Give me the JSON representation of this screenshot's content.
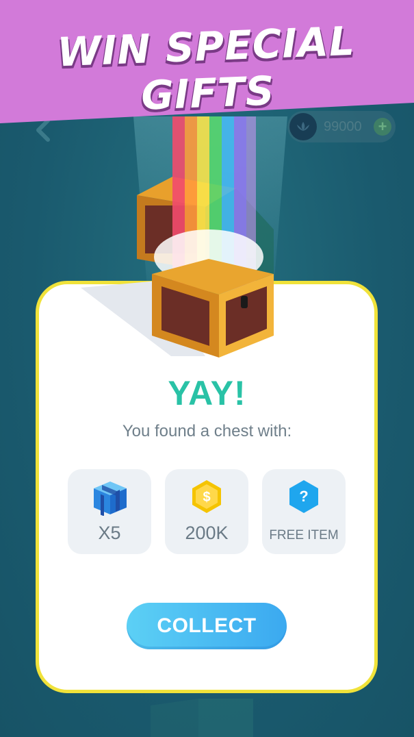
{
  "banner": {
    "title": "WIN SPECIAL GIFTS"
  },
  "header": {
    "coins": "99000",
    "plus": "+"
  },
  "card": {
    "heading": "YAY!",
    "subtitle": "You found a chest with:",
    "rewards": [
      {
        "icon": "gift-box-icon",
        "label": "X5"
      },
      {
        "icon": "coin-icon",
        "label": "200K",
        "icon_text": "$"
      },
      {
        "icon": "question-icon",
        "label": "FREE ITEM",
        "icon_text": "?"
      }
    ],
    "collect_label": "COLLECT"
  },
  "colors": {
    "banner": "#d27ad9",
    "background": "#1d5f73",
    "card_border": "#f0e23a",
    "heading": "#29c2a6",
    "button": "#3ba9f0"
  }
}
